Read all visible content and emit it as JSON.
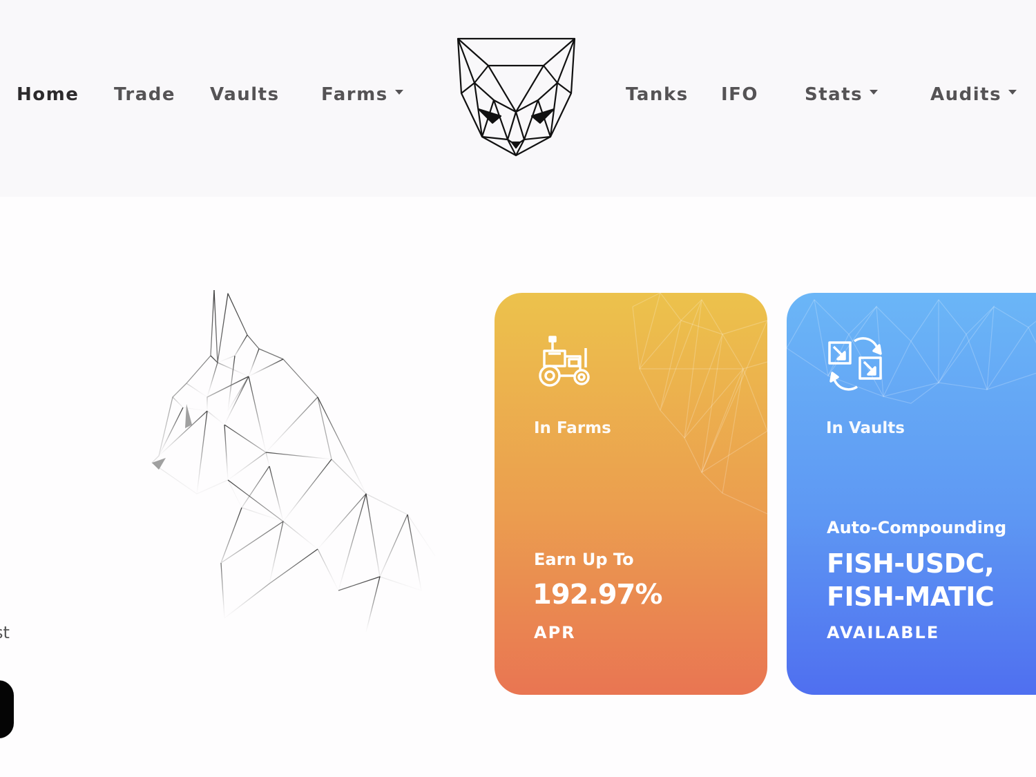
{
  "nav": {
    "left": [
      {
        "label": "Home",
        "active": true,
        "dropdown": false
      },
      {
        "label": "Trade",
        "active": false,
        "dropdown": false
      },
      {
        "label": "Vaults",
        "active": false,
        "dropdown": false
      },
      {
        "label": "Farms",
        "active": false,
        "dropdown": true
      }
    ],
    "right": [
      {
        "label": "Tanks",
        "active": false,
        "dropdown": false
      },
      {
        "label": "IFO",
        "active": false,
        "dropdown": false
      },
      {
        "label": "Stats",
        "active": false,
        "dropdown": true
      },
      {
        "label": "Audits",
        "active": false,
        "dropdown": true
      }
    ],
    "logo_icon": "cat-head-logo-icon"
  },
  "hero": {
    "cat_icon": "polygon-cat-illustration",
    "edge_text": "st"
  },
  "cards": {
    "farms": {
      "icon": "tractor-icon",
      "caption": "In Farms",
      "earn_label": "Earn Up To",
      "value": "192.97%",
      "unit": "APR",
      "color_top": "#ecc24c",
      "color_bottom": "#e97552"
    },
    "vaults": {
      "icon": "swap-compound-icon",
      "caption": "In Vaults",
      "auto_label": "Auto-Compounding",
      "pair_1": "FISH-USDC,",
      "pair_2": "FISH-MATIC",
      "status": "AVAILABLE",
      "color_top": "#6bb6f7",
      "color_bottom": "#4f6ff0"
    }
  }
}
